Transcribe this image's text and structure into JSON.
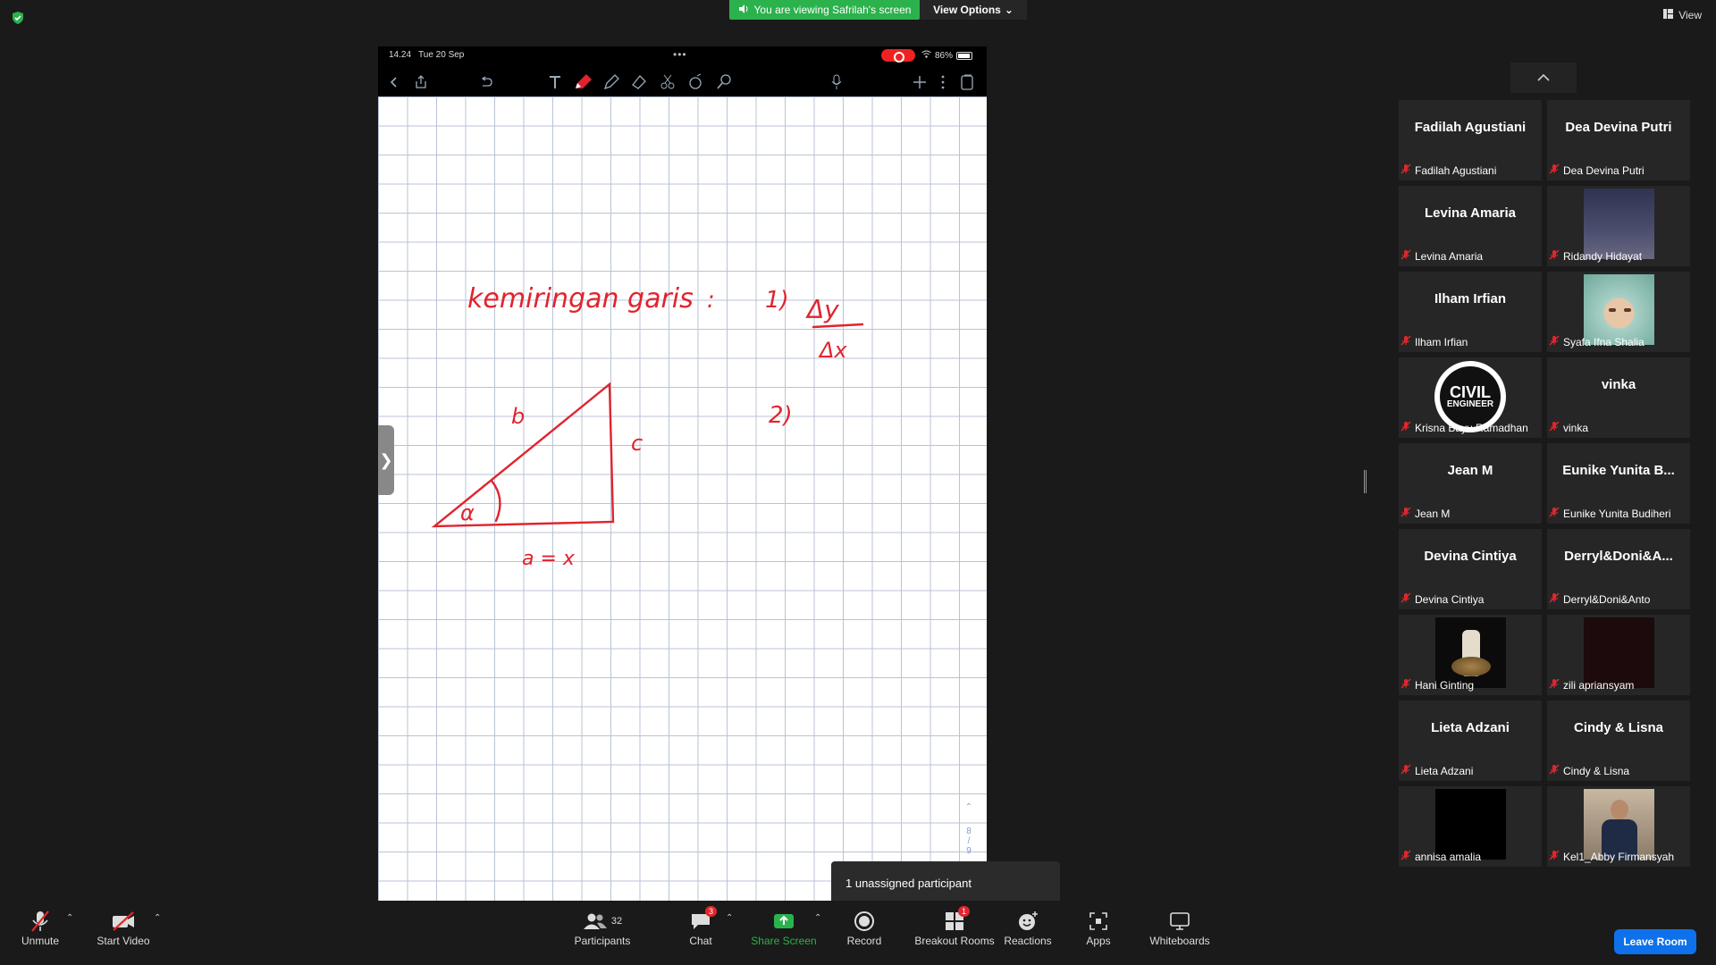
{
  "banner": {
    "viewing_text": "You are viewing Safrilah's screen",
    "view_options": "View Options",
    "view": "View"
  },
  "ipad": {
    "time": "14.24",
    "date": "Tue 20 Sep",
    "battery": "86%",
    "page_top": "8",
    "page_bottom": "9",
    "drawing": {
      "title": "kemiringan garis",
      "item1": "1)",
      "dy": "Δy",
      "dx": "Δx",
      "item2": "2)",
      "label_b": "b",
      "label_c": "c",
      "label_alpha": "α",
      "base_label": "a = x",
      "ink_color": "#e0242e"
    }
  },
  "tooltip": {
    "text": "1 unassigned participant"
  },
  "participants": [
    {
      "display": "Fadilah Agustiani",
      "label": "Fadilah Agustiani",
      "type": "name"
    },
    {
      "display": "Dea Devina Putri",
      "label": "Dea Devina Putri",
      "type": "name"
    },
    {
      "display": "Levina Amaria",
      "label": "Levina Amaria",
      "type": "name"
    },
    {
      "display": "",
      "label": "Ridandy Hidayat",
      "type": "photo-dusk"
    },
    {
      "display": "Ilham Irfian",
      "label": "Ilham Irfian",
      "type": "name"
    },
    {
      "display": "",
      "label": "Syafa Ifna Shalia",
      "type": "photo-baby"
    },
    {
      "display": "CIVIL ENGINEER",
      "label": "Krisna Bayu Ramadhan",
      "type": "logo-civil"
    },
    {
      "display": "vinka",
      "label": "vinka",
      "type": "name"
    },
    {
      "display": "Jean M",
      "label": "Jean M",
      "type": "name"
    },
    {
      "display": "Eunike Yunita B...",
      "label": "Eunike Yunita Budiheri",
      "type": "name"
    },
    {
      "display": "Devina Cintiya",
      "label": "Devina Cintiya",
      "type": "name"
    },
    {
      "display": "Derryl&Doni&A...",
      "label": "Derryl&Doni&Anto",
      "type": "name"
    },
    {
      "display": "",
      "label": "Hani Ginting",
      "type": "photo-bottle"
    },
    {
      "display": "",
      "label": "zili apriansyam",
      "type": "photo-dark"
    },
    {
      "display": "Lieta Adzani",
      "label": "Lieta Adzani",
      "type": "name"
    },
    {
      "display": "Cindy & Lisna",
      "label": "Cindy & Lisna",
      "type": "name"
    },
    {
      "display": "",
      "label": "annisa amalia",
      "type": "photo-black"
    },
    {
      "display": "",
      "label": "Kel1_Abby Firmansyah",
      "type": "photo-man"
    }
  ],
  "controls": {
    "unmute": "Unmute",
    "start_video": "Start Video",
    "participants": "Participants",
    "participants_count": "32",
    "chat": "Chat",
    "chat_badge": "3",
    "share_screen": "Share Screen",
    "record": "Record",
    "breakout_rooms": "Breakout Rooms",
    "breakout_badge": "1",
    "reactions": "Reactions",
    "apps": "Apps",
    "whiteboards": "Whiteboards",
    "leave": "Leave Room"
  },
  "colors": {
    "green": "#2bb24c",
    "leave": "#0e71eb",
    "mute_red": "#e0272d"
  }
}
